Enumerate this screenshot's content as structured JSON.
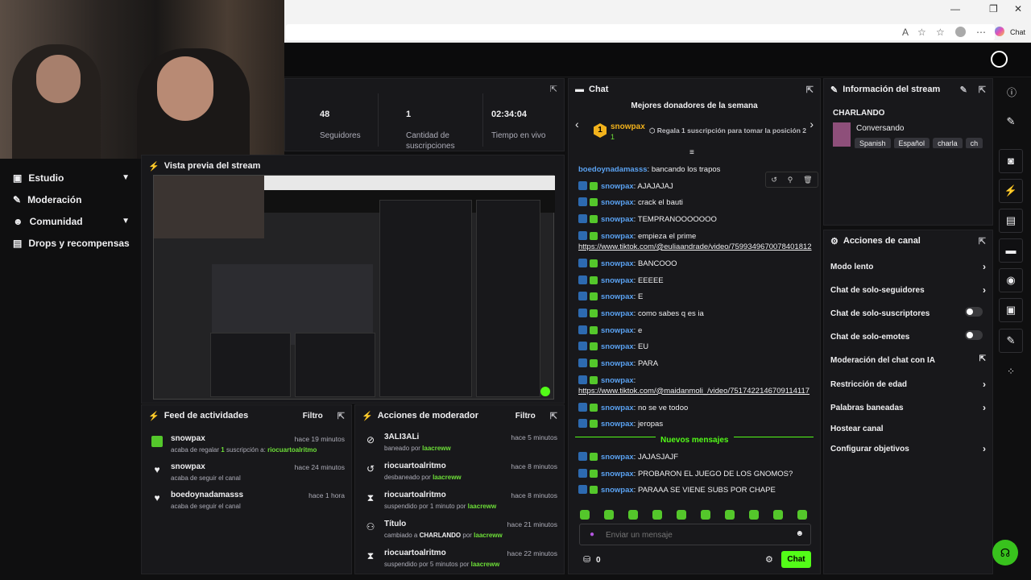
{
  "browser": {
    "chat_label": "Chat",
    "min": "—",
    "max": "❐",
    "close": "✕"
  },
  "stats": [
    {
      "value": "48",
      "label": "Seguidores"
    },
    {
      "value": "1",
      "label": "Cantidad de suscripciones"
    },
    {
      "value": "02:34:04",
      "label": "Tiempo en vivo"
    }
  ],
  "nav": [
    {
      "label": "Estudio",
      "chev": true
    },
    {
      "label": "Moderación",
      "chev": false
    },
    {
      "label": "Comunidad",
      "chev": true
    },
    {
      "label": "Drops y recompensas",
      "chev": false
    }
  ],
  "preview": {
    "title": "Vista previa del stream"
  },
  "feed": {
    "title": "Feed de actividades",
    "filter": "Filtro",
    "items": [
      {
        "user": "snowpax",
        "time": "hace 19 minutos",
        "pre": "acaba de regalar ",
        "num": "1",
        "mid": " suscripción a: ",
        "target": "riocuartoalritmo"
      },
      {
        "user": "snowpax",
        "time": "hace 24 minutos",
        "pre": "acaba de seguir el canal"
      },
      {
        "user": "boedoynadamasss",
        "time": "hace 1 hora",
        "pre": "acaba de seguir el canal"
      }
    ]
  },
  "modactions": {
    "title": "Acciones de moderador",
    "filter": "Filtro",
    "items": [
      {
        "icon": "⊘",
        "user": "3ALI3ALi",
        "time": "hace 5 minutos",
        "pre": "baneado por ",
        "by": "laacreww"
      },
      {
        "icon": "↺",
        "user": "riocuartoalritmo",
        "time": "hace 8 minutos",
        "pre": "desbaneado por ",
        "by": "laacreww"
      },
      {
        "icon": "⧗",
        "user": "riocuartoalritmo",
        "time": "hace 8 minutos",
        "pre": "suspendido por 1 minuto por ",
        "by": "laacreww"
      },
      {
        "icon": "⚇",
        "user": "Título",
        "time": "hace 21 minutos",
        "pre": "cambiado a ",
        "bold": "CHARLANDO",
        "mid": " por ",
        "by": "laacreww"
      },
      {
        "icon": "⧗",
        "user": "riocuartoalritmo",
        "time": "hace 22 minutos",
        "pre": "suspendido por 5 minutos por ",
        "by": "laacreww"
      }
    ]
  },
  "chat": {
    "title": "Chat",
    "donors_title": "Mejores donadores de la semana",
    "donor_name": "snowpax",
    "donor_count": "1",
    "donor_rank": "1",
    "donor_cta": "Regala 1 suscripción para tomar la posición 2",
    "messages": [
      {
        "user": "boedoynadamasss",
        "text": "bancando los trapos",
        "badges": false
      },
      {
        "user": "snowpax",
        "text": "AJAJAJAJ",
        "badges": true
      },
      {
        "user": "snowpax",
        "text": "crack el bauti",
        "badges": true
      },
      {
        "user": "snowpax",
        "text": "TEMPRANOOOOOOO",
        "badges": true
      },
      {
        "user": "snowpax",
        "text": "empieza el prime",
        "badges": true,
        "link": "https://www.tiktok.com/@euliaandrade/video/7599349670078401812"
      },
      {
        "user": "snowpax",
        "text": "BANCOOO",
        "badges": true
      },
      {
        "user": "snowpax",
        "text": "EEEEE",
        "badges": true
      },
      {
        "user": "snowpax",
        "text": "E",
        "badges": true
      },
      {
        "user": "snowpax",
        "text": "como sabes q es ia",
        "badges": true
      },
      {
        "user": "snowpax",
        "text": "e",
        "badges": true
      },
      {
        "user": "snowpax",
        "text": "EU",
        "badges": true
      },
      {
        "user": "snowpax",
        "text": "PARA",
        "badges": true
      },
      {
        "user": "snowpax",
        "text": "",
        "badges": true,
        "link": "https://www.tiktok.com/@maidanmoli_/video/7517422146709114117"
      },
      {
        "user": "snowpax",
        "text": "no se ve todoo",
        "badges": true
      },
      {
        "user": "snowpax",
        "text": "jeropas",
        "badges": true
      }
    ],
    "new_label": "Nuevos mensajes",
    "new_messages": [
      {
        "user": "snowpax",
        "text": "JAJASJAJF"
      },
      {
        "user": "snowpax",
        "text": "PROBARON EL JUEGO DE LOS GNOMOS?"
      },
      {
        "user": "snowpax",
        "text": "PARAAA SE VIENE SUBS POR CHAPE"
      }
    ],
    "input_placeholder": "Enviar un mensaje",
    "points": "0",
    "send_label": "Chat"
  },
  "info": {
    "title": "Información del stream",
    "stream_title": "CHARLANDO",
    "category": "Conversando",
    "tags": [
      "Spanish",
      "Español",
      "charla",
      "ch"
    ]
  },
  "channel": {
    "title": "Acciones de canal",
    "items": [
      {
        "label": "Modo lento",
        "kind": "chev"
      },
      {
        "label": "Chat de solo-seguidores",
        "kind": "chev"
      },
      {
        "label": "Chat de solo-suscriptores",
        "kind": "toggle"
      },
      {
        "label": "Chat de solo-emotes",
        "kind": "toggle"
      },
      {
        "label": "Moderación del chat con IA",
        "kind": "ext"
      },
      {
        "label": "Restricción de edad",
        "kind": "chev"
      },
      {
        "label": "Palabras baneadas",
        "kind": "chev"
      },
      {
        "label": "Hostear canal",
        "kind": "none"
      },
      {
        "label": "Configurar objetivos",
        "kind": "chev"
      }
    ]
  },
  "colors": {
    "accent": "#53fc18",
    "bg": "#0f0f10",
    "panel": "#18181b",
    "user_blue": "#5aa2f2"
  }
}
